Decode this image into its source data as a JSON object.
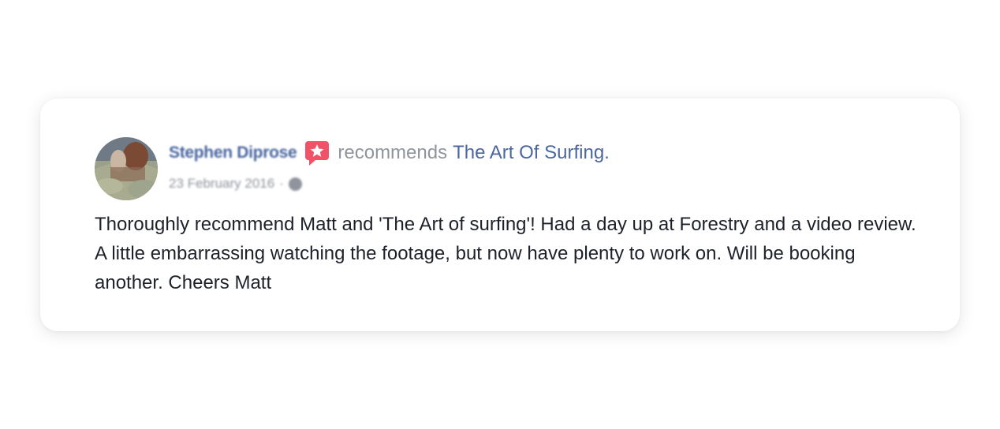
{
  "review": {
    "author": "Stephen Diprose",
    "recommends_text": "recommends",
    "page_name": "The Art Of Surfing.",
    "date": "23 February 2016",
    "separator": "·",
    "privacy_icon": "globe-icon",
    "badge_icon": "recommendation-star-icon",
    "text": "Thoroughly recommend Matt and 'The Art of surfing'! Had a day up at Forestry and a video review. A little embarrassing watching the footage, but now have plenty to work on. Will be booking another. Cheers Matt"
  },
  "colors": {
    "link": "#4b67a1",
    "muted": "#90949c",
    "body_text": "#1d2129",
    "badge": "#f25268"
  }
}
